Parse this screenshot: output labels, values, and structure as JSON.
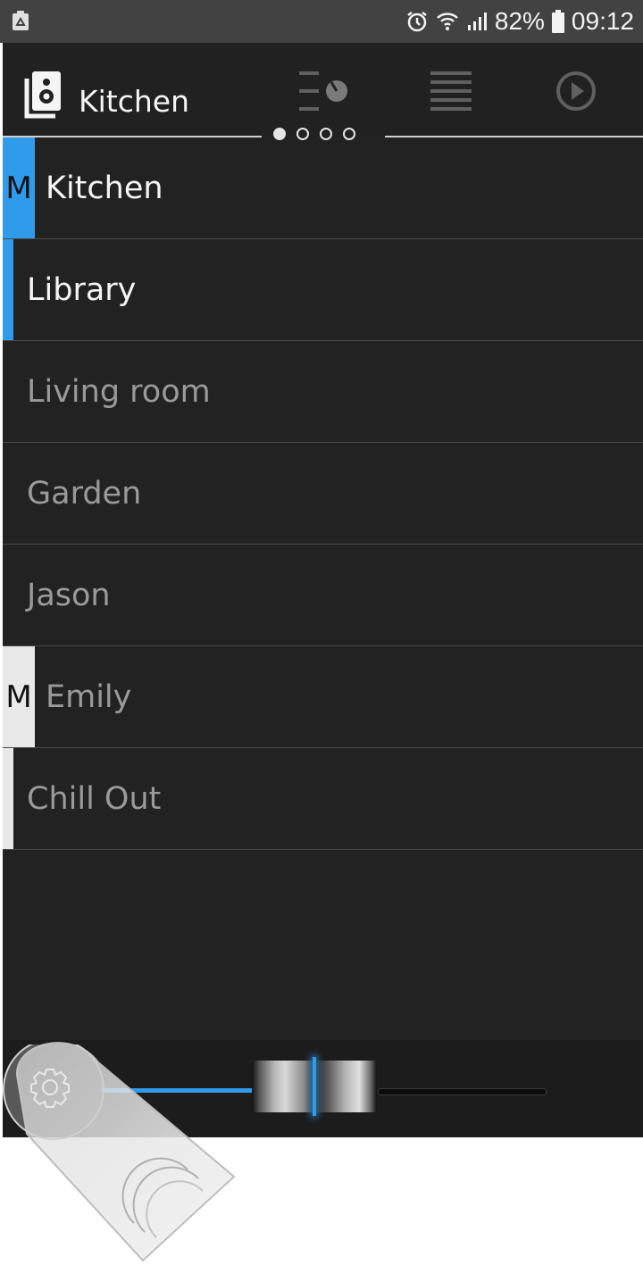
{
  "status_bar": {
    "battery": "82%",
    "time": "09:12",
    "icons": [
      "recycle-icon",
      "alarm-icon",
      "wifi-icon",
      "signal-icon",
      "battery-icon"
    ]
  },
  "header": {
    "current_zone": "Kitchen",
    "zone_icon": "speaker-icon",
    "tabs": [
      {
        "name": "equalizer-tab",
        "icon": "equalizer-knob-icon"
      },
      {
        "name": "queue-tab",
        "icon": "list-icon"
      },
      {
        "name": "now-playing-tab",
        "icon": "play-circle-icon"
      }
    ],
    "page_indicator": {
      "count": 4,
      "active": 0
    }
  },
  "zones": [
    {
      "name": "Kitchen",
      "badge": "M",
      "state": "master-active"
    },
    {
      "name": "Library",
      "badge": "",
      "state": "linked-active"
    },
    {
      "name": "Living room",
      "badge": "",
      "state": "inactive"
    },
    {
      "name": "Garden",
      "badge": "",
      "state": "inactive"
    },
    {
      "name": "Jason",
      "badge": "",
      "state": "inactive"
    },
    {
      "name": "Emily",
      "badge": "M",
      "state": "master-other"
    },
    {
      "name": "Chill Out",
      "badge": "",
      "state": "linked-other"
    }
  ],
  "volume": {
    "level": 0.48,
    "settings_icon": "gear-icon"
  },
  "colors": {
    "accent": "#2f9bea",
    "background": "#222222",
    "text_active": "#f5f5f5",
    "text_inactive": "#9a9a9a",
    "marker_other": "#e8e8e8"
  }
}
